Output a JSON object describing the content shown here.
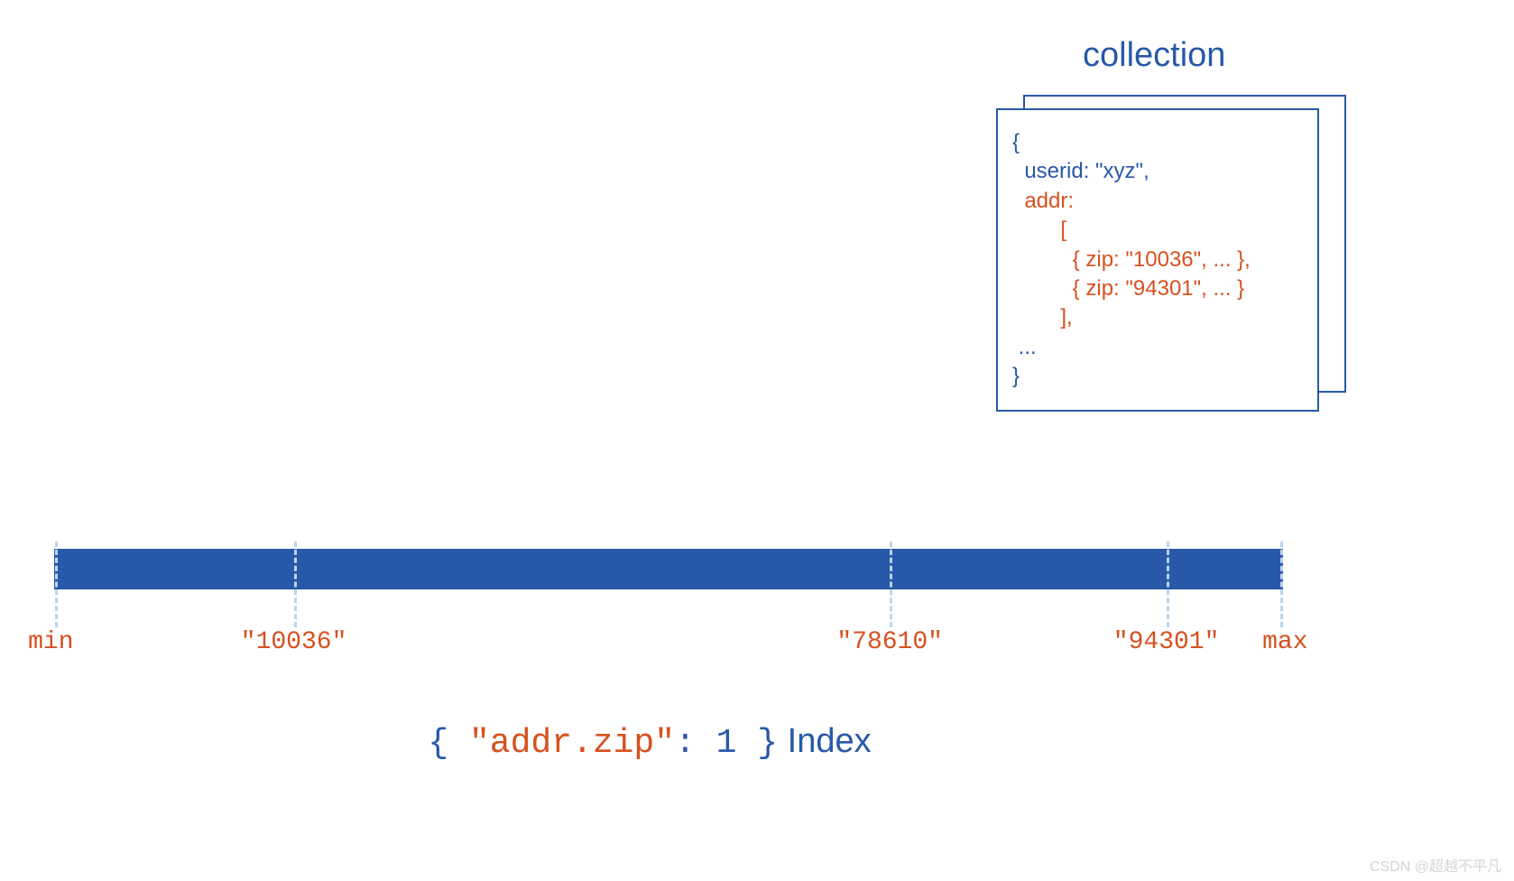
{
  "collection": {
    "title": "collection",
    "document": {
      "open_brace": "{",
      "userid_line": "  userid: \"xyz\",",
      "addr_line": "  addr:",
      "arr_open": "        [",
      "zip1": "          { zip: \"10036\", ... },",
      "zip2": "          { zip: \"94301\", ... }",
      "arr_close": "        ],",
      "ellipsis": " ...",
      "close_brace": "}"
    }
  },
  "index_bar": {
    "ticks": [
      {
        "pos_pct": 0.1,
        "label": "min"
      },
      {
        "pos_pct": 19.5,
        "label": "\"10036\""
      },
      {
        "pos_pct": 68.0,
        "label": "\"78610\""
      },
      {
        "pos_pct": 90.5,
        "label": "\"94301\""
      },
      {
        "pos_pct": 99.8,
        "label": "max"
      }
    ]
  },
  "index_title": {
    "open": "{ ",
    "key": "\"addr.zip\"",
    "colon_val": ": 1 ",
    "close": "}",
    "word": " Index"
  },
  "watermark": "CSDN @超越不平凡",
  "colors": {
    "blue": "#2859a8",
    "orange": "#d6511f",
    "tick_dash": "#b8d6ed"
  }
}
